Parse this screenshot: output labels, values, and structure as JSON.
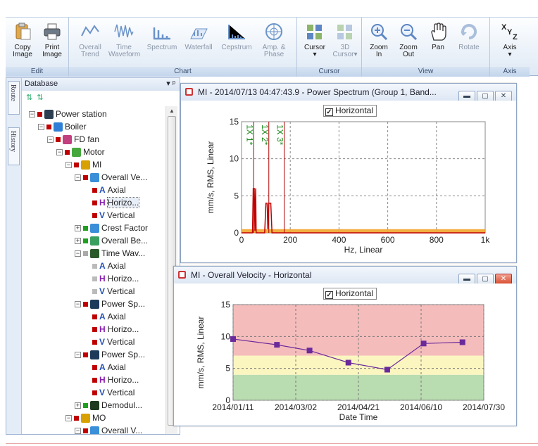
{
  "ribbon": {
    "groups": [
      {
        "label": "Edit",
        "buttons": [
          {
            "line1": "Copy",
            "line2": "Image"
          },
          {
            "line1": "Print",
            "line2": "Image"
          }
        ]
      },
      {
        "label": "Chart",
        "buttons": [
          {
            "line1": "Overall",
            "line2": "Trend"
          },
          {
            "line1": "Time",
            "line2": "Waveform"
          },
          {
            "line1": "Spectrum",
            "line2": ""
          },
          {
            "line1": "Waterfall",
            "line2": ""
          },
          {
            "line1": "Cepstrum",
            "line2": ""
          },
          {
            "line1": "Amp. &",
            "line2": "Phase"
          }
        ]
      },
      {
        "label": "Cursor",
        "buttons": [
          {
            "line1": "Cursor",
            "line2": "▾"
          },
          {
            "line1": "3D",
            "line2": "Cursor▾"
          }
        ]
      },
      {
        "label": "View",
        "buttons": [
          {
            "line1": "Zoom",
            "line2": "In"
          },
          {
            "line1": "Zoom",
            "line2": "Out"
          },
          {
            "line1": "Pan",
            "line2": ""
          },
          {
            "line1": "Rotate",
            "line2": ""
          }
        ]
      },
      {
        "label": "Axis",
        "buttons": [
          {
            "line1": "Axis",
            "line2": "▾"
          }
        ]
      }
    ]
  },
  "side_tabs": {
    "route": "Route",
    "history": "History"
  },
  "database": {
    "title": "Database",
    "pin": "▾ ᵖ"
  },
  "tree": [
    {
      "label": "Power station",
      "level": 0,
      "exp": "−",
      "sq": "#c00000",
      "icon": "#2c3e50"
    },
    {
      "label": "Boiler",
      "level": 1,
      "exp": "−",
      "sq": "#c00000",
      "icon": "#2f7fd6"
    },
    {
      "label": "FD fan",
      "level": 2,
      "exp": "−",
      "sq": "#c00000",
      "icon": "#c04080"
    },
    {
      "label": "Motor",
      "level": 3,
      "exp": "−",
      "sq": "#c00000",
      "icon": "#46a83c"
    },
    {
      "label": "MI",
      "level": 4,
      "exp": "−",
      "sq": "#c00000",
      "icon": "#d8a000"
    },
    {
      "label": "Overall Ve...",
      "level": 5,
      "exp": "−",
      "sq": "#c00000",
      "icon": "#3a8fd8"
    },
    {
      "label": "Axial",
      "level": 6,
      "sq": "#c00000",
      "letter": "A"
    },
    {
      "label": "Horizo...",
      "level": 6,
      "sq": "#c00000",
      "letter": "H",
      "selected": true
    },
    {
      "label": "Vertical",
      "level": 6,
      "sq": "#c00000",
      "letter": "V"
    },
    {
      "label": "Crest Factor",
      "level": 5,
      "exp": "+",
      "sq": "#20a020",
      "icon": "#3a8fd8"
    },
    {
      "label": "Overall Be...",
      "level": 5,
      "exp": "+",
      "sq": "#20a020",
      "icon": "#3aa060"
    },
    {
      "label": "Time Wav...",
      "level": 5,
      "exp": "−",
      "sq": "#aaaaaa",
      "icon": "#2a5a2a"
    },
    {
      "label": "Axial",
      "level": 6,
      "sq": "#bbbbbb",
      "letter": "A"
    },
    {
      "label": "Horizo...",
      "level": 6,
      "sq": "#bbbbbb",
      "letter": "H"
    },
    {
      "label": "Vertical",
      "level": 6,
      "sq": "#bbbbbb",
      "letter": "V"
    },
    {
      "label": "Power Sp...",
      "level": 5,
      "exp": "−",
      "sq": "#c00000",
      "icon": "#1e3a5a"
    },
    {
      "label": "Axial",
      "level": 6,
      "sq": "#c00000",
      "letter": "A"
    },
    {
      "label": "Horizo...",
      "level": 6,
      "sq": "#c00000",
      "letter": "H"
    },
    {
      "label": "Vertical",
      "level": 6,
      "sq": "#c00000",
      "letter": "V"
    },
    {
      "label": "Power Sp...",
      "level": 5,
      "exp": "−",
      "sq": "#c00000",
      "icon": "#1e3a5a"
    },
    {
      "label": "Axial",
      "level": 6,
      "sq": "#c00000",
      "letter": "A"
    },
    {
      "label": "Horizo...",
      "level": 6,
      "sq": "#c00000",
      "letter": "H"
    },
    {
      "label": "Vertical",
      "level": 6,
      "sq": "#c00000",
      "letter": "V"
    },
    {
      "label": "Demodul...",
      "level": 5,
      "exp": "+",
      "sq": "#20a020",
      "icon": "#1e3a1e"
    },
    {
      "label": "MO",
      "level": 4,
      "exp": "−",
      "sq": "#c00000",
      "icon": "#d8a000"
    },
    {
      "label": "Overall V...",
      "level": 5,
      "exp": "−",
      "sq": "#c00000",
      "icon": "#3a8fd8"
    }
  ],
  "spectrum_window": {
    "title": "MI - 2014/07/13 04:47:43.9 - Power Spectrum (Group 1, Band...",
    "legend": "Horizontal"
  },
  "trend_window": {
    "title": "MI - Overall Velocity - Horizontal",
    "legend": "Horizontal"
  },
  "chart_data": [
    {
      "type": "line",
      "title": "",
      "legend": [
        "Horizontal"
      ],
      "xlabel": "Hz, Linear",
      "ylabel": "mm/s, RMS, Linear",
      "xlim": [
        0,
        1000
      ],
      "ylim": [
        0,
        15
      ],
      "x_ticks": [
        "0",
        "200",
        "400",
        "600",
        "800",
        "1k"
      ],
      "y_ticks": [
        "0",
        "5",
        "10",
        "15"
      ],
      "grid": true,
      "cursors": [
        {
          "label": "1X 1*",
          "x": 50
        },
        {
          "label": "1X 2*",
          "x": 112
        },
        {
          "label": "1X 3*",
          "x": 175
        }
      ],
      "series": [
        {
          "name": "Horizontal",
          "x": [
            0,
            45,
            48,
            52,
            55,
            58,
            60,
            95,
            100,
            105,
            108,
            112,
            120,
            125,
            1000
          ],
          "y": [
            0,
            0,
            6,
            6,
            0.3,
            6,
            0,
            0,
            4,
            4,
            0.5,
            4,
            4,
            0,
            0
          ]
        }
      ],
      "baseline": 0.5
    },
    {
      "type": "line",
      "title": "",
      "legend": [
        "Horizontal"
      ],
      "xlabel": "Date Time",
      "ylabel": "mm/s, RMS, Linear",
      "xlim": [
        "2014/01/11",
        "2014/07/30"
      ],
      "ylim": [
        0,
        15
      ],
      "x_ticks": [
        "2014/01/11",
        "2014/03/02",
        "2014/04/21",
        "2014/06/10",
        "2014/07/30"
      ],
      "y_ticks": [
        "0",
        "5",
        "10",
        "15"
      ],
      "grid": true,
      "bands": [
        {
          "from": 0,
          "to": 4,
          "color": "#b9dcb0"
        },
        {
          "from": 4,
          "to": 7,
          "color": "#fbf6c0"
        },
        {
          "from": 7,
          "to": 15,
          "color": "#f5bcbc"
        }
      ],
      "series": [
        {
          "name": "Horizontal",
          "x": [
            "2014/01/11",
            "2014/02/15",
            "2014/03/13",
            "2014/04/13",
            "2014/05/14",
            "2014/06/12",
            "2014/07/13"
          ],
          "y": [
            9.6,
            8.7,
            7.8,
            5.9,
            4.8,
            8.9,
            9.1
          ]
        }
      ]
    }
  ]
}
